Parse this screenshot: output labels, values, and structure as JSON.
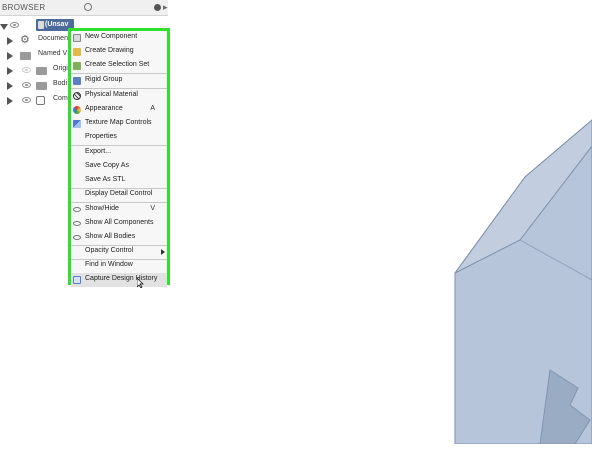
{
  "browser": {
    "title": "BROWSER",
    "root_label": "(Unsav",
    "items": [
      {
        "label": "Document"
      },
      {
        "label": "Named V"
      },
      {
        "label": "Origi"
      },
      {
        "label": "Bodi"
      },
      {
        "label": "Comp"
      }
    ]
  },
  "context_menu": {
    "items": [
      {
        "label": "New Component",
        "icon": "new-component-icon"
      },
      {
        "label": "Create Drawing",
        "icon": "drawing-icon"
      },
      {
        "label": "Create Selection Set",
        "icon": "selection-set-icon"
      },
      {
        "label": "Rigid Group",
        "icon": "rigid-group-icon"
      },
      {
        "label": "Physical Material",
        "icon": "physical-material-icon"
      },
      {
        "label": "Appearance",
        "icon": "appearance-icon",
        "shortcut": "A"
      },
      {
        "label": "Texture Map Controls",
        "icon": "texture-map-icon"
      },
      {
        "label": "Properties"
      },
      {
        "label": "Export..."
      },
      {
        "label": "Save Copy As"
      },
      {
        "label": "Save As STL"
      },
      {
        "label": "Display Detail Control"
      },
      {
        "label": "Show/Hide",
        "icon": "eye-icon",
        "shortcut": "V"
      },
      {
        "label": "Show All Components",
        "icon": "eye-icon"
      },
      {
        "label": "Show All Bodies",
        "icon": "eye-icon"
      },
      {
        "label": "Opacity Control"
      },
      {
        "label": "Find in Window"
      },
      {
        "label": "Capture Design History",
        "icon": "design-history-icon"
      }
    ]
  },
  "colors": {
    "highlight_border": "#2fe02f",
    "model_fill": "#b7c5da",
    "model_edge": "#7d8fa8",
    "root_selection": "#4d6b9a"
  }
}
